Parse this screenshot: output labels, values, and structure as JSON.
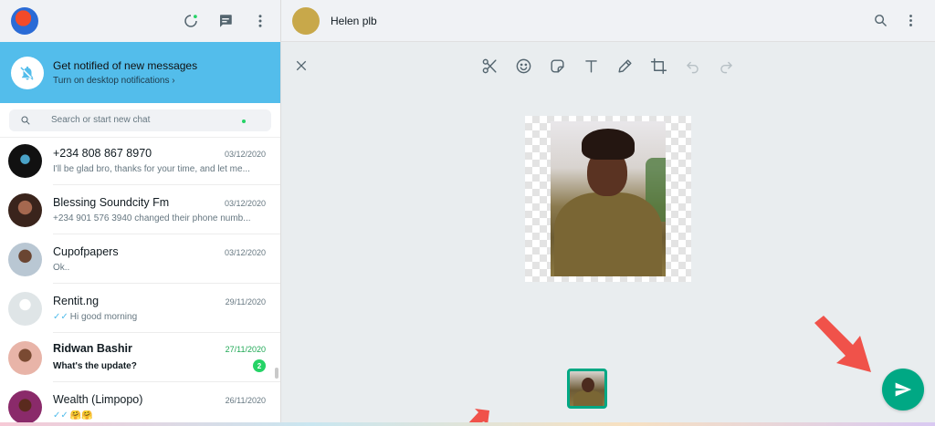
{
  "sidebar": {
    "notification": {
      "title": "Get notified of new messages",
      "subtitle": "Turn on desktop notifications ›"
    },
    "search": {
      "placeholder": "Search or start new chat"
    },
    "chats": [
      {
        "name": "+234 808 867 8970",
        "date": "03/12/2020",
        "preview": "I'll be glad bro, thanks for your time, and let me...",
        "avatar_color": "#111111"
      },
      {
        "name": "Blessing Soundcity Fm",
        "date": "03/12/2020",
        "preview": "+234 901 576 3940 changed their phone numb...",
        "avatar_color": "#6b4a3a"
      },
      {
        "name": "Cupofpapers",
        "date": "03/12/2020",
        "preview": "Ok..",
        "avatar_color": "#8fa3b3"
      },
      {
        "name": "Rentit.ng",
        "date": "29/11/2020",
        "preview": "Hi good morning",
        "ticks": "✓✓",
        "avatar_color": "#dfe5e7"
      },
      {
        "name": "Ridwan Bashir",
        "date": "27/11/2020",
        "preview": "What's the update?",
        "badge": "2",
        "unread": true,
        "avatar_color": "#d9a08f"
      },
      {
        "name": "Wealth (Limpopo)",
        "date": "26/11/2020",
        "preview": "🤗🤗",
        "ticks": "✓✓",
        "avatar_color": "#7a2a5a"
      }
    ]
  },
  "main": {
    "contact_name": "Helen plb",
    "colors": {
      "accent": "#00a884",
      "annotation_arrow": "#f0524a"
    }
  }
}
